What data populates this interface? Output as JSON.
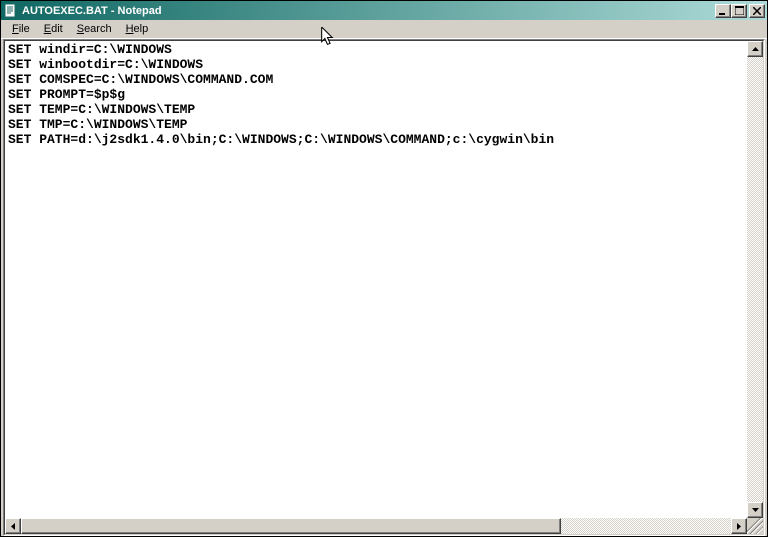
{
  "title": "AUTOEXEC.BAT - Notepad",
  "menu": {
    "file": "File",
    "edit": "Edit",
    "search": "Search",
    "help": "Help"
  },
  "content": "SET windir=C:\\WINDOWS\nSET winbootdir=C:\\WINDOWS\nSET COMSPEC=C:\\WINDOWS\\COMMAND.COM\nSET PROMPT=$p$g\nSET TEMP=C:\\WINDOWS\\TEMP\nSET TMP=C:\\WINDOWS\\TEMP\nSET PATH=d:\\j2sdk1.4.0\\bin;C:\\WINDOWS;C:\\WINDOWS\\COMMAND;c:\\cygwin\\bin",
  "icons": {
    "app": "notepad-icon",
    "minimize": "minimize-icon",
    "maximize": "maximize-icon",
    "close": "close-icon"
  }
}
